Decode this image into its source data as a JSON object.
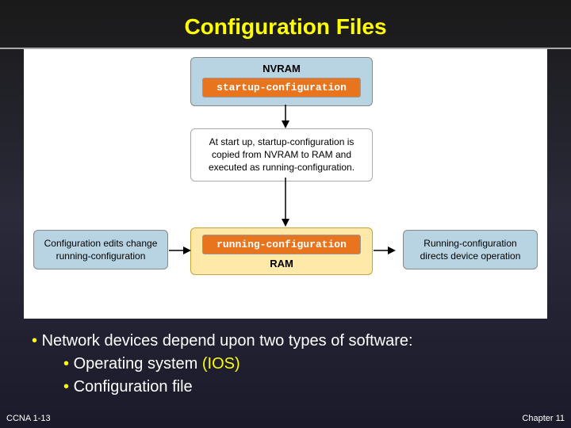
{
  "title": "Configuration Files",
  "diagram": {
    "nvram_label": "NVRAM",
    "startup_config": "startup-configuration",
    "explain": "At start up, startup-configuration is copied from NVRAM to RAM and executed as running-configuration.",
    "running_config": "running-configuration",
    "ram_label": "RAM",
    "left_box": "Configuration edits change running-configuration",
    "right_box": "Running-configuration directs device operation"
  },
  "bullets": {
    "main": "Network devices depend upon two types of software:",
    "sub1_prefix": "Operating system ",
    "sub1_ios": "(IOS)",
    "sub2": "Configuration file"
  },
  "footer": {
    "left": "CCNA 1-13",
    "right": "Chapter 11"
  }
}
